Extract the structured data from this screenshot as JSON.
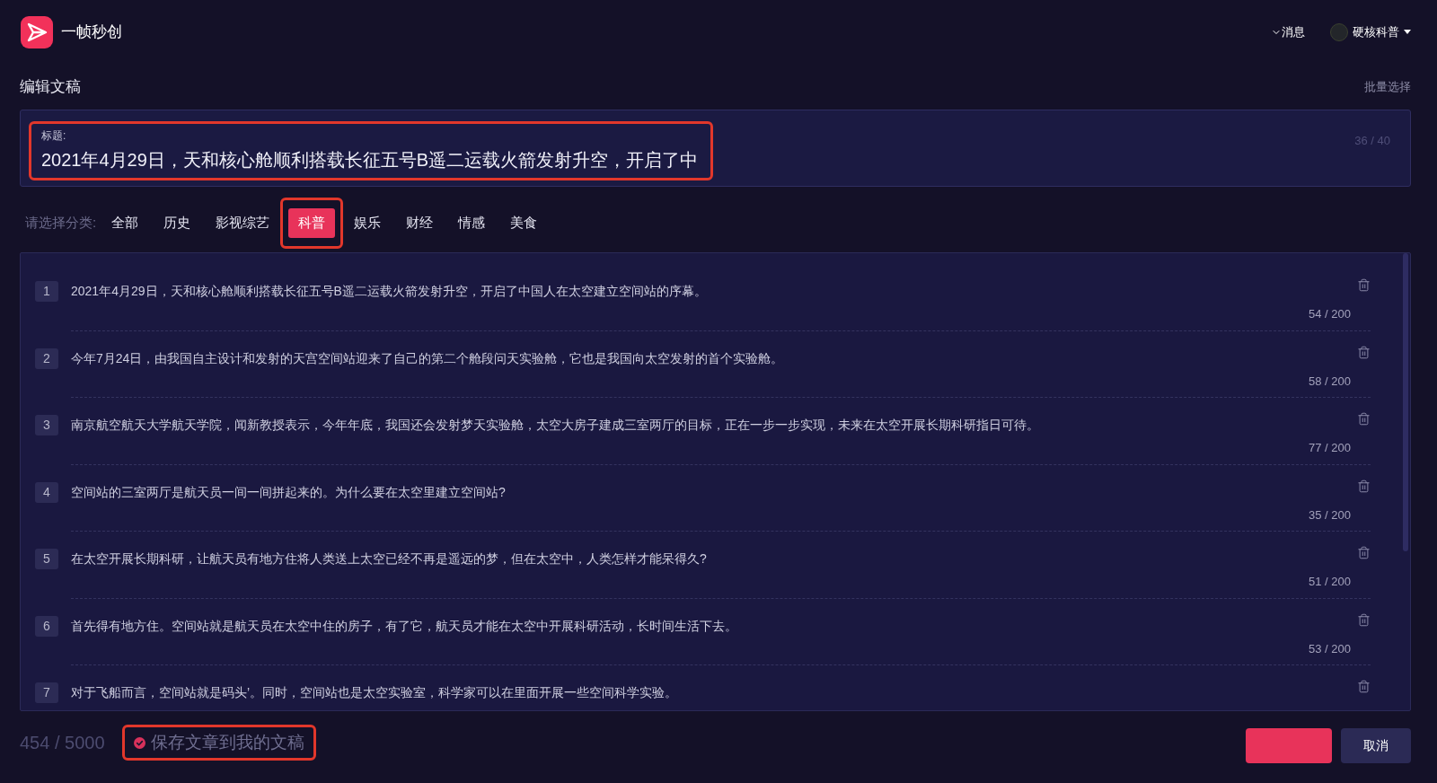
{
  "app": {
    "name": "一帧秒创"
  },
  "header": {
    "messages": "消息",
    "user": {
      "name": "硬核科普"
    }
  },
  "page": {
    "title": "编辑文稿",
    "batch_select": "批量选择"
  },
  "title_field": {
    "label": "标题:",
    "value": "2021年4月29日，天和核心舱顺利搭载长征五号B遥二运载火箭发射升空，开启了中",
    "counter": "36 / 40",
    "highlighted": true
  },
  "categories": {
    "label": "请选择分类:",
    "items": [
      {
        "label": "全部",
        "selected": false,
        "highlighted": false
      },
      {
        "label": "历史",
        "selected": false,
        "highlighted": false
      },
      {
        "label": "影视综艺",
        "selected": false,
        "highlighted": false
      },
      {
        "label": "科普",
        "selected": true,
        "highlighted": true
      },
      {
        "label": "娱乐",
        "selected": false,
        "highlighted": false
      },
      {
        "label": "财经",
        "selected": false,
        "highlighted": false
      },
      {
        "label": "情感",
        "selected": false,
        "highlighted": false
      },
      {
        "label": "美食",
        "selected": false,
        "highlighted": false
      }
    ]
  },
  "paragraphs": [
    {
      "number": "1",
      "text": "2021年4月29日，天和核心舱顺利搭载长征五号B遥二运载火箭发射升空，开启了中国人在太空建立空间站的序幕。",
      "counter": "54 / 200"
    },
    {
      "number": "2",
      "text": "今年7月24日，由我国自主设计和发射的天宫空间站迎来了自己的第二个舱段问天实验舱，它也是我国向太空发射的首个实验舱。",
      "counter": "58 / 200"
    },
    {
      "number": "3",
      "text": "南京航空航天大学航天学院，闻新教授表示，今年年底，我国还会发射梦天实验舱，太空大房子建成三室两厅的目标，正在一步一步实现，未来在太空开展长期科研指日可待。",
      "counter": "77 / 200"
    },
    {
      "number": "4",
      "text": "空间站的三室两厅是航天员一间一间拼起来的。为什么要在太空里建立空间站?",
      "counter": "35 / 200"
    },
    {
      "number": "5",
      "text": "在太空开展长期科研，让航天员有地方住将人类送上太空已经不再是遥远的梦，但在太空中，人类怎样才能呆得久?",
      "counter": "51 / 200"
    },
    {
      "number": "6",
      "text": "首先得有地方住。空间站就是航天员在太空中住的房子，有了它，航天员才能在太空中开展科研活动，长时间生活下去。",
      "counter": "53 / 200"
    },
    {
      "number": "7",
      "text": "对于飞船而言，空间站就是码头’。同时，空间站也是太空实验室，科学家可以在里面开展一些空间科学实验。"
    }
  ],
  "footer": {
    "total": "454 / 5000",
    "save": {
      "label": "保存文章到我的文稿",
      "checked": true,
      "highlighted": true
    },
    "buttons": [
      {
        "kind": "primary"
      },
      {
        "kind": "secondary",
        "label": "取消"
      }
    ]
  }
}
